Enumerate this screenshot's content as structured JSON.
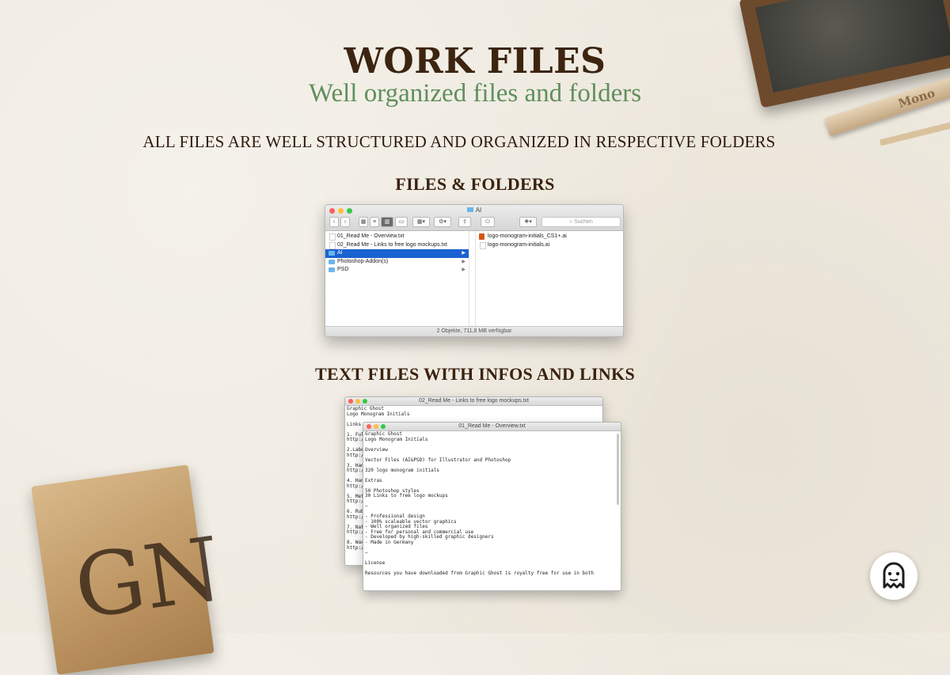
{
  "header": {
    "title": "WORK FILES",
    "subtitle": "Well organized files and folders",
    "description": "ALL FILES ARE WELL STRUCTURED AND ORGANIZED IN RESPECTIVE FOLDERS"
  },
  "sections": {
    "files_folders": "FILES & FOLDERS",
    "text_files": "TEXT FILES WITH INFOS AND LINKS"
  },
  "finder": {
    "window_title": "AI",
    "search_placeholder": "Suchen",
    "left_column": [
      {
        "label": "01_Read Me - Overview.txt",
        "type": "doc"
      },
      {
        "label": "02_Read Me - Links to free logo mockups.txt",
        "type": "doc"
      },
      {
        "label": "AI",
        "type": "folder",
        "selected": true
      },
      {
        "label": "Photoshop-Addon(s)",
        "type": "folder"
      },
      {
        "label": "PSD",
        "type": "folder"
      }
    ],
    "right_column": [
      {
        "label": "logo-monogram-initials_CS1+.ai",
        "type": "ai"
      },
      {
        "label": "logo-monogram-initials.ai",
        "type": "doc"
      }
    ],
    "status": "2 Objekte, 711,8 MB verfügbar"
  },
  "editor_back": {
    "title": "02_Read Me - Links to free logo mockups.txt",
    "text": "Graphic Ghost\nLogo Monogram Initials\n\nLinks\n\n1. Ful\nhttp:/\n\n2.Labe\nhttp:/\n\n3. Han\nhttp:/\n\n4. Han\nhttp:/\n\n5. Met\nhttp:/\n\n6. Rub\nhttp:/\n\n7. Nat\nhttp:/\n\n8. Wax\nhttp:/"
  },
  "editor_front": {
    "title": "01_Read Me - Overview.txt",
    "text": "Graphic Ghost\nLogo Monogram Initials\n\nOverview\n\nVector Files (AI&PSD) for Illustrator and Photoshop\n\n320 logo monogram initials\n\nExtras\n\n50 Photoshop styles\n30 Links to free logo mockups\n\n—\n\n- Professional design\n- 100% scaleable vector graphics\n- Well organized files\n- Free for personal and commercial use\n- Developed by high-skilled graphic designers\n- Made in Germany\n\n—\n\nLicense\n\nResources you have downloaded from Graphic Ghost is royalty free for use in both"
  },
  "decor": {
    "pencil_text": "Mono",
    "bag_monogram": "GN"
  },
  "colors": {
    "title": "#3c2410",
    "subtitle": "#5f8f5c",
    "selection": "#1a62d2",
    "traffic_red": "#fc605c",
    "traffic_yellow": "#fdbc40",
    "traffic_green": "#34c84a"
  }
}
